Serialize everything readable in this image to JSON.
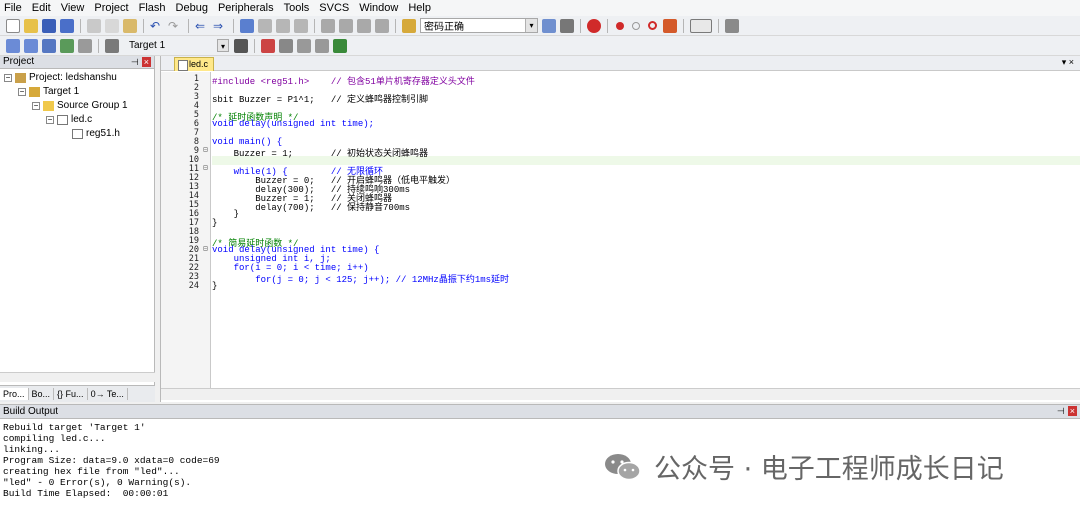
{
  "menubar": [
    "File",
    "Edit",
    "View",
    "Project",
    "Flash",
    "Debug",
    "Peripherals",
    "Tools",
    "SVCS",
    "Window",
    "Help"
  ],
  "toolbar": {
    "search_combo": "密码正确"
  },
  "toolbar2": {
    "target_select": "Target 1"
  },
  "project_panel": {
    "title": "Project",
    "tree": {
      "project": "Project: ledshanshu",
      "target": "Target 1",
      "group": "Source Group 1",
      "file": "led.c",
      "header": "reg51.h"
    },
    "tabs": [
      "Pro...",
      "Bo...",
      "{} Fu...",
      "0→ Te..."
    ]
  },
  "editor": {
    "active_tab": "led.c",
    "line_numbers": [
      "1",
      "2",
      "3",
      "4",
      "5",
      "6",
      "7",
      "8",
      "9",
      "10",
      "11",
      "12",
      "13",
      "14",
      "15",
      "16",
      "17",
      "18",
      "19",
      "20",
      "21",
      "22",
      "23",
      "24"
    ],
    "code": {
      "l1": "#include <reg51.h>    // 包含51单片机寄存器定义头文件",
      "l3": "sbit Buzzer = P1^1;   // 定义蜂鸣器控制引脚",
      "l5": "/* 延时函数声明 */",
      "l6": "void delay(unsigned int time);",
      "l8": "void main() {",
      "l9": "    Buzzer = 1;       // 初始状态关闭蜂鸣器",
      "l11": "    while(1) {        // 无限循环",
      "l12": "        Buzzer = 0;   // 开启蜂鸣器（低电平触发）",
      "l13": "        delay(300);   // 持续鸣响300ms",
      "l14": "        Buzzer = 1;   // 关闭蜂鸣器",
      "l15": "        delay(700);   // 保持静音700ms",
      "l16": "    }",
      "l17": "}",
      "l19": "/* 简易延时函数 */",
      "l20": "void delay(unsigned int time) {",
      "l21": "    unsigned int i, j;",
      "l22": "    for(i = 0; i < time; i++)",
      "l23": "        for(j = 0; j < 125; j++); // 12MHz晶振下约1ms延时",
      "l24": "}"
    }
  },
  "build_output": {
    "title": "Build Output",
    "lines": [
      "Rebuild target 'Target 1'",
      "compiling led.c...",
      "linking...",
      "Program Size: data=9.0 xdata=0 code=69",
      "creating hex file from \"led\"...",
      "\"led\" - 0 Error(s), 0 Warning(s).",
      "Build Time Elapsed:  00:00:01"
    ]
  },
  "watermark": "公众号 · 电子工程师成长日记"
}
